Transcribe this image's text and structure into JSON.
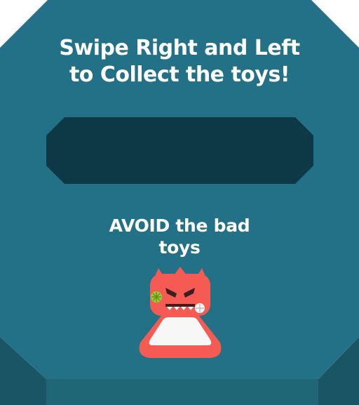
{
  "instructions": {
    "line1": "Swipe Right and Left",
    "line2": "to Collect the toys!"
  },
  "warning": {
    "line1": "AVOID the bad",
    "line2": "toys"
  },
  "colors": {
    "board": "#237186",
    "board_shadow": "#1a5566",
    "board_front": "#1f6677",
    "collect_bar": "#0d3845",
    "text": "#ffffff",
    "monster_body": "#f55a53",
    "monster_belly": "#f7f7f7",
    "monster_patch": "#9acd32"
  },
  "icons": {
    "bad_toy": "angry-red-monster-icon"
  }
}
